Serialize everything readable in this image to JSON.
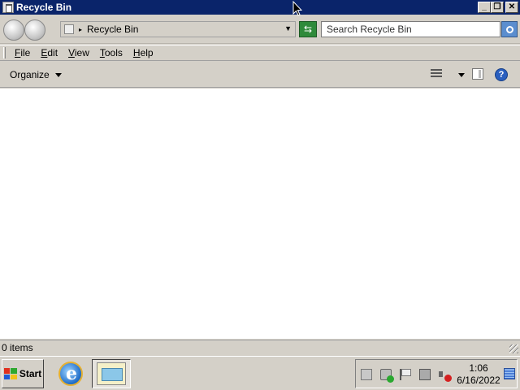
{
  "window": {
    "title": "Recycle Bin",
    "controls": {
      "minimize": "_",
      "restore": "❐",
      "close": "✕"
    }
  },
  "address_bar": {
    "location": "Recycle Bin",
    "separator": "▸",
    "dropdown": "▼",
    "refresh_glyph": "⇆"
  },
  "search": {
    "placeholder": "Search Recycle Bin"
  },
  "menu": {
    "items": [
      {
        "label": "File",
        "accel": "F",
        "rest": "ile"
      },
      {
        "label": "Edit",
        "accel": "E",
        "rest": "dit"
      },
      {
        "label": "View",
        "accel": "V",
        "rest": "iew"
      },
      {
        "label": "Tools",
        "accel": "T",
        "rest": "ools"
      },
      {
        "label": "Help",
        "accel": "H",
        "rest": "elp"
      }
    ]
  },
  "command_bar": {
    "organize_label": "Organize",
    "help_glyph": "?"
  },
  "status_bar": {
    "item_count": "0 items"
  },
  "taskbar": {
    "start_label": "Start",
    "clock_time": "1:06",
    "clock_date": "6/16/2022"
  },
  "colors": {
    "title_bar": "#0a246a",
    "chrome": "#d4d0c8",
    "content_bg": "#ffffff",
    "windows_logo": [
      "#e0301e",
      "#2fa82f",
      "#1e5bd6",
      "#f2c21a"
    ]
  },
  "icons": {
    "title": "recycle-bin-icon",
    "address": "recycle-bin-icon",
    "refresh": "refresh-icon",
    "search": "search-icon",
    "views": "views-icon",
    "preview_pane": "preview-pane-icon",
    "help": "help-icon",
    "quick_launch": "internet-explorer-icon",
    "tray": [
      "server-manager-icon",
      "security-shield-icon",
      "action-center-flag-icon",
      "network-icon",
      "volume-muted-icon",
      "keyboard-language-icon"
    ]
  }
}
